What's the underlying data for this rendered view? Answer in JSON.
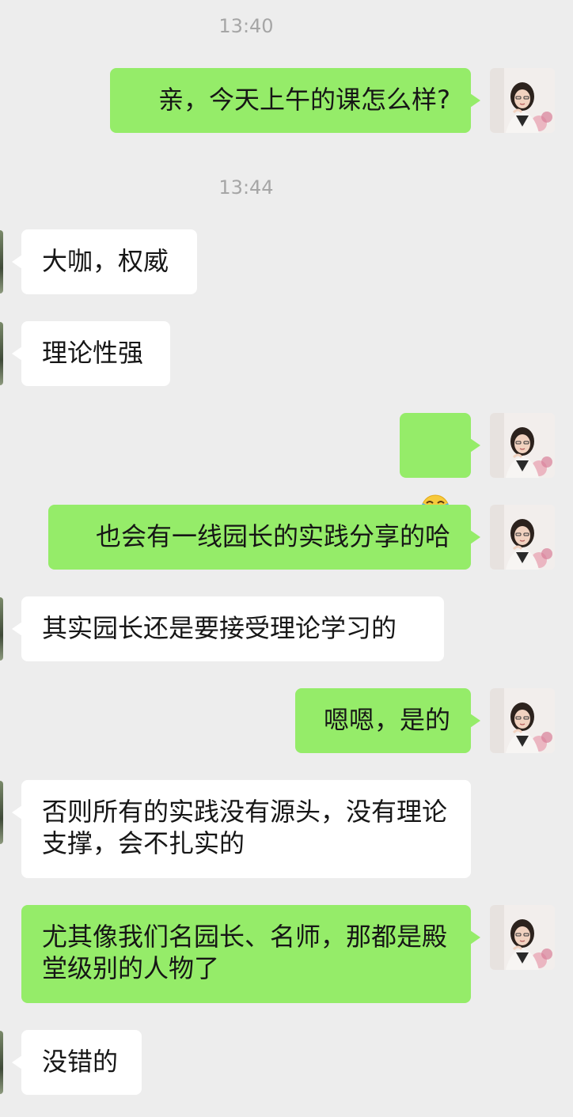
{
  "timestamps": [
    "13:40",
    "13:44"
  ],
  "messages": [
    {
      "sender": "me",
      "text": "亲，今天上午的课怎么样?"
    },
    {
      "sender": "other",
      "text": "大咖，权威"
    },
    {
      "sender": "other",
      "text": "理论性强"
    },
    {
      "sender": "me",
      "emoji": "face-with-tears-of-joy-emoji"
    },
    {
      "sender": "me",
      "text": "也会有一线园长的实践分享的哈"
    },
    {
      "sender": "other",
      "text": "其实园长还是要接受理论学习的"
    },
    {
      "sender": "me",
      "text": "嗯嗯，是的"
    },
    {
      "sender": "other",
      "text": "否则所有的实践没有源头，没有理论支撑，会不扎实的"
    },
    {
      "sender": "me",
      "text": "尤其像我们名园长、名师，那都是殿堂级别的人物了"
    },
    {
      "sender": "other",
      "text": "没错的"
    }
  ],
  "colors": {
    "background": "#ededed",
    "outgoing_bubble": "#95ec69",
    "incoming_bubble": "#ffffff",
    "timestamp": "#a6a6a6",
    "text": "#161616"
  }
}
